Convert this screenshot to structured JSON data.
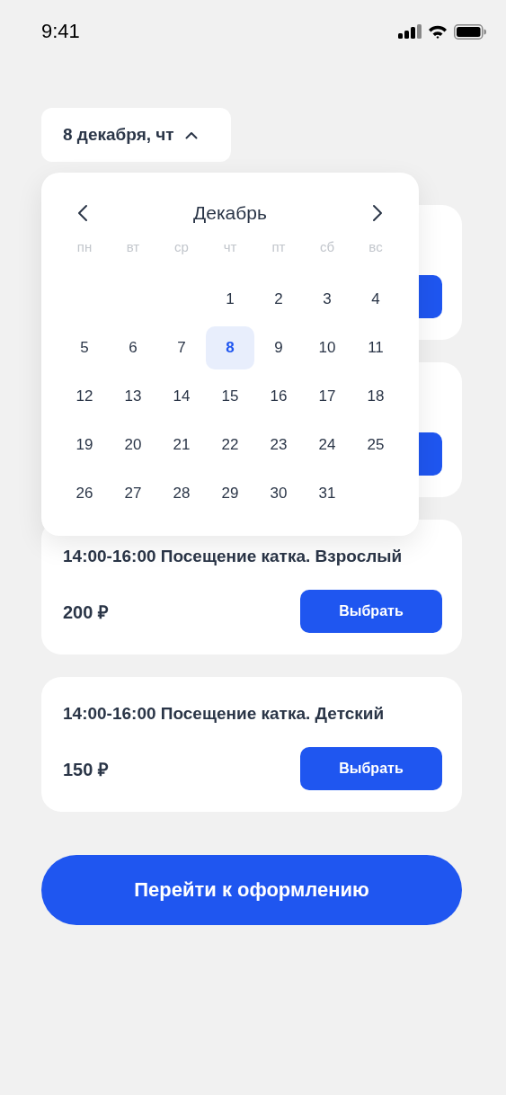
{
  "status_bar": {
    "time": "9:41"
  },
  "date_picker": {
    "label": "8 декабря, чт",
    "expanded": true
  },
  "calendar": {
    "month": "Декабрь",
    "weekdays": [
      "пн",
      "вт",
      "ср",
      "чт",
      "пт",
      "сб",
      "вс"
    ],
    "weeks": [
      {
        "kind": "first",
        "days": [
          {
            "day": "1",
            "selected": false
          },
          {
            "day": "2",
            "selected": false
          },
          {
            "day": "3",
            "selected": false
          },
          {
            "day": "4",
            "selected": false
          }
        ]
      },
      {
        "kind": "full",
        "days": [
          {
            "day": "5",
            "selected": false
          },
          {
            "day": "6",
            "selected": false
          },
          {
            "day": "7",
            "selected": false
          },
          {
            "day": "8",
            "selected": true
          },
          {
            "day": "9",
            "selected": false
          },
          {
            "day": "10",
            "selected": false
          },
          {
            "day": "11",
            "selected": false
          }
        ]
      },
      {
        "kind": "full",
        "days": [
          {
            "day": "12",
            "selected": false
          },
          {
            "day": "13",
            "selected": false
          },
          {
            "day": "14",
            "selected": false
          },
          {
            "day": "15",
            "selected": false
          },
          {
            "day": "16",
            "selected": false
          },
          {
            "day": "17",
            "selected": false
          },
          {
            "day": "18",
            "selected": false
          }
        ]
      },
      {
        "kind": "full",
        "days": [
          {
            "day": "19",
            "selected": false
          },
          {
            "day": "20",
            "selected": false
          },
          {
            "day": "21",
            "selected": false
          },
          {
            "day": "22",
            "selected": false
          },
          {
            "day": "23",
            "selected": false
          },
          {
            "day": "24",
            "selected": false
          },
          {
            "day": "25",
            "selected": false
          }
        ]
      },
      {
        "kind": "last",
        "days": [
          {
            "day": "26",
            "selected": false
          },
          {
            "day": "27",
            "selected": false
          },
          {
            "day": "28",
            "selected": false
          },
          {
            "day": "29",
            "selected": false
          },
          {
            "day": "30",
            "selected": false
          },
          {
            "day": "31",
            "selected": false
          }
        ]
      }
    ]
  },
  "offers": [
    {
      "covered": true
    },
    {
      "covered": true
    },
    {
      "covered": false,
      "title": "14:00-16:00 Посещение катка. Взрослый",
      "price": "200 ₽",
      "button": "Выбрать"
    },
    {
      "covered": false,
      "title": "14:00-16:00 Посещение катка. Детский",
      "price": "150 ₽",
      "button": "Выбрать"
    }
  ],
  "checkout_button": "Перейти к оформлению"
}
